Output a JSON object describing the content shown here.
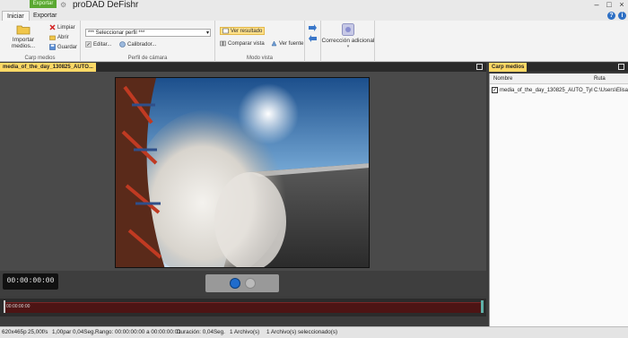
{
  "titlebar": {
    "export_badge": "Exportar",
    "title": "proDAD DeFishr",
    "logo": "⚙"
  },
  "tabs": [
    {
      "label": "Iniciar",
      "active": true
    },
    {
      "label": "Exportar",
      "active": false
    }
  ],
  "ribbon": {
    "carp_medios": {
      "import_label": "Importar medios...",
      "limpiar": "Limpiar",
      "abrir": "Abrir",
      "guardar": "Guardar",
      "group_label": "Carp medios"
    },
    "perfil": {
      "select_value": "*** Seleccionar perfil ***",
      "editar": "Editar...",
      "calibrador": "Calibrador...",
      "group_label": "Perfil de cámara"
    },
    "modo_vista": {
      "ver_resultado": "Ver resultado",
      "comparar_vista": "Comparar vista",
      "ver_fuente": "Ver fuente",
      "group_label": "Modo vista"
    },
    "correccion": {
      "label": "Corrección adicional"
    }
  },
  "video_panel": {
    "tab_label": "media_of_the_day_130825_AUTO..."
  },
  "controls": {
    "timecode": "00:00:00:00"
  },
  "timeline": {
    "time": "00:00:00:00"
  },
  "media_panel": {
    "tab_label": "Carp medios",
    "col_name": "Nombre",
    "col_path": "Ruta",
    "rows": [
      {
        "checked": true,
        "name": "media_of_the_day_130825_AUTO_Tyl...",
        "path": "C:\\Users\\Elisab"
      }
    ]
  },
  "status": {
    "resolution": "620x465p",
    "fps": "25,00f/s",
    "par": "1,00par",
    "length": "0,04Seg.",
    "range": "Rango: 00:00:00:00 a 00:00:00:01",
    "duration": "Duración: 0,04Seg.",
    "files": "1 Archivo(s)",
    "selected": "1 Archivo(s) seleccionado(s)"
  },
  "colors": {
    "accent_tab": "#ffd966",
    "export_badge": "#5aa832",
    "timeline_track": "#4d1414",
    "play_button": "#1f6ccc"
  }
}
